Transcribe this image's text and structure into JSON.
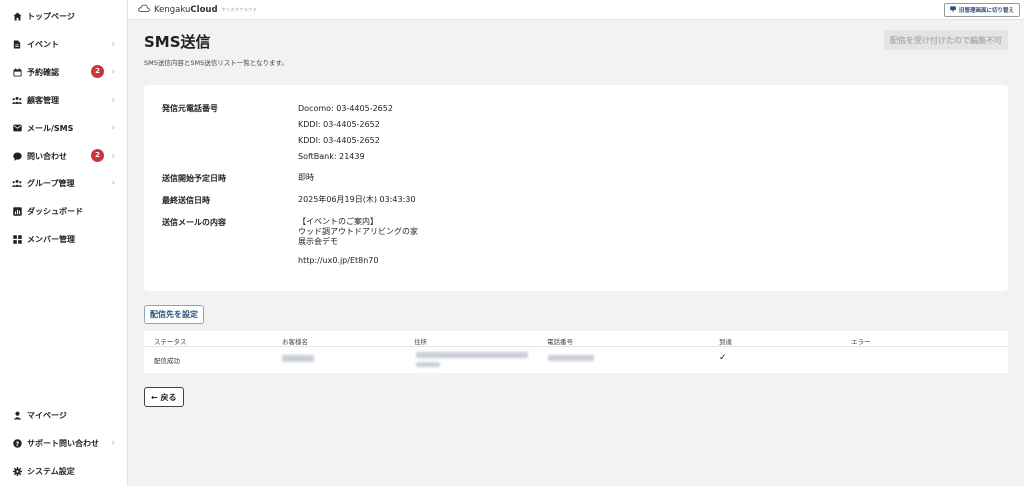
{
  "sidebar": {
    "items": [
      {
        "label": "トップページ",
        "icon": "home-icon"
      },
      {
        "label": "イベント",
        "icon": "document-icon"
      },
      {
        "label": "予約確認",
        "icon": "calendar-icon",
        "badge": "2"
      },
      {
        "label": "顧客管理",
        "icon": "people-icon"
      },
      {
        "label": "メール/SMS",
        "icon": "mail-icon"
      },
      {
        "label": "問い合わせ",
        "icon": "chat-icon",
        "badge": "2"
      },
      {
        "label": "グループ管理",
        "icon": "group-icon"
      },
      {
        "label": "ダッシュボード",
        "icon": "chart-icon"
      },
      {
        "label": "メンバー管理",
        "icon": "grid-icon"
      }
    ],
    "bottom_items": [
      {
        "label": "マイページ",
        "icon": "user-icon"
      },
      {
        "label": "サポート問い合わせ",
        "icon": "help-icon"
      },
      {
        "label": "システム設定",
        "icon": "gear-icon"
      }
    ]
  },
  "topbar": {
    "logo_light": "Kengaku",
    "logo_bold": "Cloud",
    "logo_tag": "ケンガククラウド",
    "switch_label": "旧管理画面に切り替え"
  },
  "page": {
    "title": "SMS送信",
    "subtitle": "SMS送信内容とSMS送信リスト一覧となります。",
    "locked_label": "配信を受け付けたので編集不可"
  },
  "details": {
    "sender_label": "発信元電話番号",
    "sender_values": [
      "Docomo: 03-4405-2652",
      "KDDI: 03-4405-2652",
      "KDDI: 03-4405-2652",
      "SoftBank: 21439"
    ],
    "start_label": "送信開始予定日時",
    "start_value": "即時",
    "last_label": "最終送信日時",
    "last_value": "2025年06月19日(木) 03:43:30",
    "content_label": "送信メールの内容",
    "content_lines": [
      "【イベントのご案内】",
      "ウッド調アウトドアリビングの家",
      "展示会デモ",
      "http://ux0.jp/Et8n70"
    ]
  },
  "actions": {
    "set_destination": "配信先を設定",
    "back": "← 戻る"
  },
  "table": {
    "headers": [
      "ステータス",
      "お客様名",
      "住所",
      "電話番号",
      "到達",
      "エラー"
    ],
    "rows": [
      {
        "status": "配信成功",
        "delivered": "✓"
      }
    ]
  }
}
